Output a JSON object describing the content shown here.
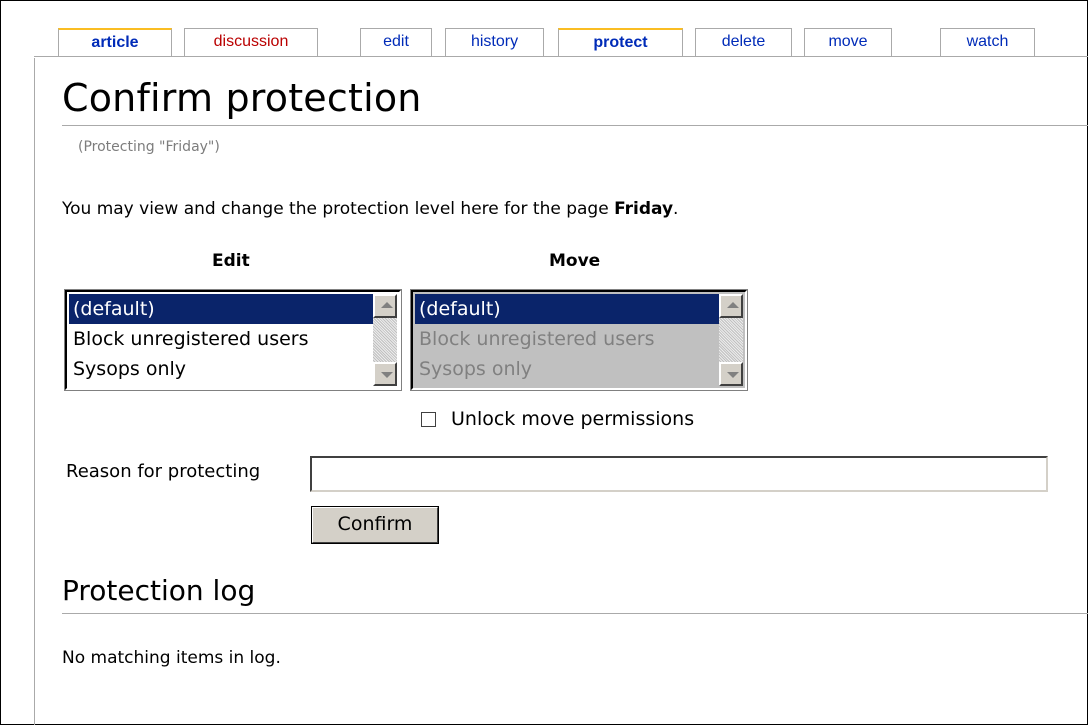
{
  "tabs": [
    {
      "label": "article"
    },
    {
      "label": "discussion"
    },
    {
      "label": "edit"
    },
    {
      "label": "history"
    },
    {
      "label": "protect"
    },
    {
      "label": "delete"
    },
    {
      "label": "move"
    },
    {
      "label": "watch"
    }
  ],
  "page": {
    "title": "Confirm protection",
    "subtitle": "(Protecting \"Friday\")",
    "intro_text": "You may view and change the protection level here for the page ",
    "intro_page": "Friday",
    "intro_end": "."
  },
  "edit_column": {
    "heading": "Edit",
    "options": [
      "(default)",
      "Block unregistered users",
      "Sysops only"
    ],
    "selected": "(default)"
  },
  "move_column": {
    "heading": "Move",
    "options": [
      "(default)",
      "Block unregistered users",
      "Sysops only"
    ],
    "selected": "(default)",
    "disabled": true
  },
  "unlock_label": "Unlock move permissions",
  "reason": {
    "label": "Reason for protecting",
    "value": ""
  },
  "confirm_label": "Confirm",
  "log": {
    "heading": "Protection log",
    "empty_text": "No matching items in log."
  },
  "colors": {
    "link": "#002bb8",
    "new_link": "#ba0000",
    "selected_tab_accent": "#fabd23",
    "selection_bg": "#0a246a"
  }
}
